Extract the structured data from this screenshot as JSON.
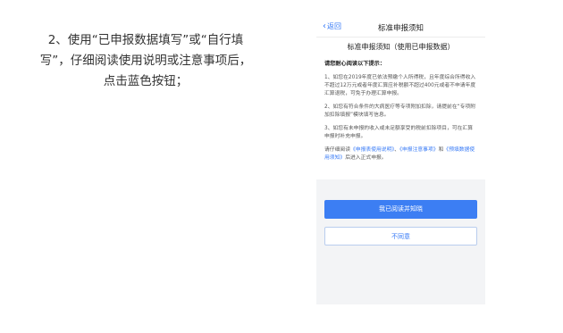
{
  "instruction": {
    "line1": "2、使用“已申报数据填写”或“自行填",
    "line2": "写”，仔细阅读使用说明或注意事项后，",
    "line3": "点击蓝色按钮；"
  },
  "phone": {
    "nav": {
      "back_label": "返回",
      "title": "标准申报须知"
    },
    "notice": {
      "title": "标准申报须知（使用已申报数据）",
      "lead": "请您耐心阅读以下提示：",
      "item1": "1、如您在2019年度已依法预缴个人所得税，且年度综合所得收入不超过12万元或者年度汇算应补税额不超过400元或者不申请年度汇算退税，可免于办理汇算申报。",
      "item2": "2、如您有符合条件的大病医疗等专项附加扣除，请提前在“专项附加扣除填报”模块填写信息。",
      "item3": "3、如您有未申报的收入或未足额享受的税前扣除项目，可在汇算申报时补充申报。",
      "guide_prefix": "请仔细阅读",
      "link1": "《申报表使用说明》",
      "sep": "、",
      "link2": "《申报注意事项》",
      "and": "和",
      "link3": "《预填数据使用须知》",
      "guide_suffix": "后进入正式申报。"
    },
    "buttons": {
      "agree": "我已阅读并知晓",
      "disagree": "不同意"
    }
  }
}
